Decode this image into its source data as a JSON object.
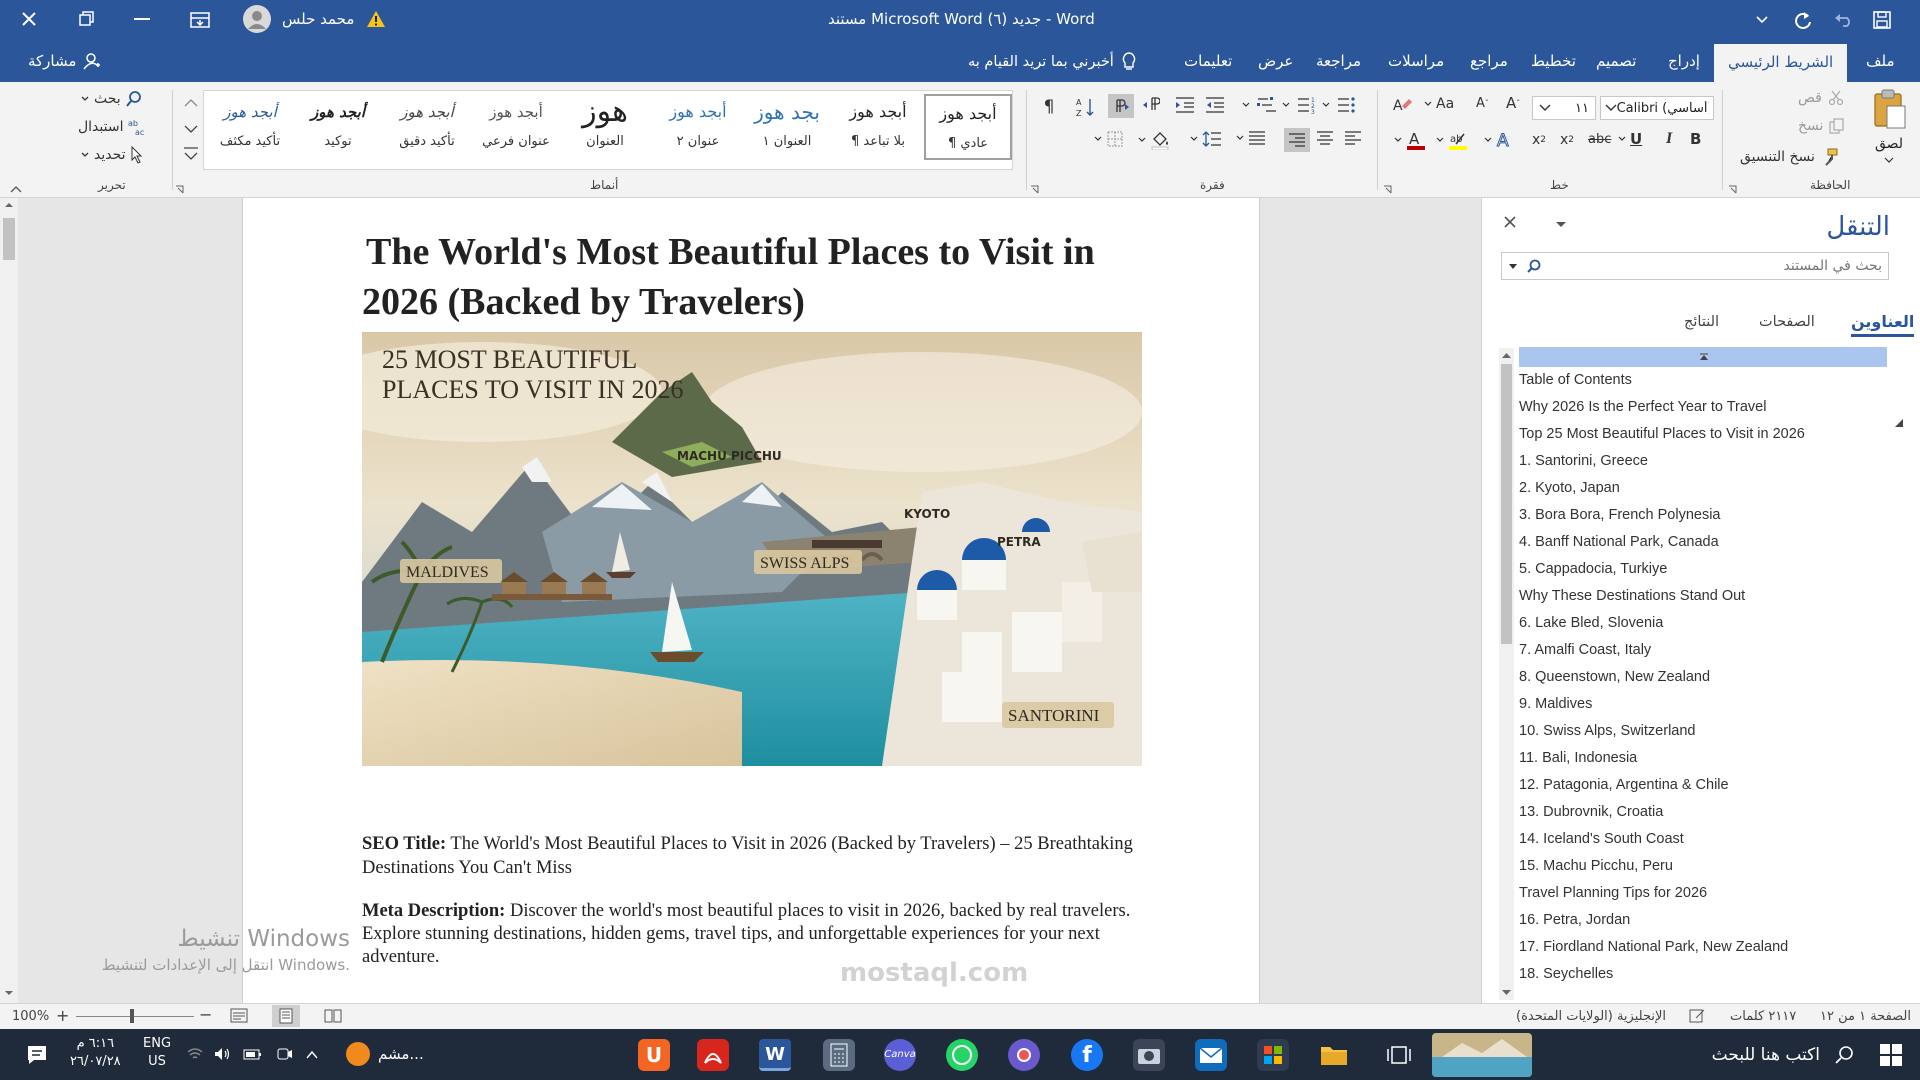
{
  "titlebar": {
    "doc_title": "مستند Microsoft Word جديد (٦)  -  Word",
    "user_name": "محمد حلس"
  },
  "tabs": [
    "ملف",
    "الشريط الرئيسي",
    "إدراج",
    "تصميم",
    "تخطيط",
    "مراجع",
    "مراسلات",
    "مراجعة",
    "عرض",
    "تعليمات"
  ],
  "tell_me": "أخبرني بما تريد القيام به",
  "share": "مشاركة",
  "ribbon": {
    "clipboard": {
      "paste": "لصق",
      "cut": "قص",
      "copy": "نسخ",
      "format_painter": "نسخ التنسيق",
      "label": "الحافظة"
    },
    "font": {
      "name": "Calibri (أساسي)",
      "size": "١١",
      "label": "خط"
    },
    "paragraph": {
      "label": "فقرة"
    },
    "styles": {
      "label": "أنماط",
      "items": [
        {
          "preview": "أبجد هوز",
          "name": "¶ عادي"
        },
        {
          "preview": "أبجد هوز",
          "name": "¶ بلا تباعد"
        },
        {
          "preview": "بجد هوز",
          "name": "العنوان ١"
        },
        {
          "preview": "أبجد هوز",
          "name": "عنوان ٢"
        },
        {
          "preview": "هوز",
          "name": "العنوان"
        },
        {
          "preview": "أبجد هوز",
          "name": "عنوان فرعي"
        },
        {
          "preview": "أبجد هوز",
          "name": "تأكيد دقيق"
        },
        {
          "preview": "أبجد هوز",
          "name": "توكيد"
        },
        {
          "preview": "أبجد هوز",
          "name": "تأكيد مكثف"
        }
      ]
    },
    "editing": {
      "find": "بحث",
      "replace": "استبدال",
      "select": "تحديد",
      "label": "تحرير"
    }
  },
  "document": {
    "title_line1": "The World's Most Beautiful Places to Visit in",
    "title_line2": "2026 (Backed by Travelers)",
    "image": {
      "heading_line1": "25 MOST BEAUTIFUL",
      "heading_line2": "PLACES TO VISIT IN 2026",
      "labels": [
        "MACHU PICCHU",
        "KYOTO",
        "PETRA",
        "MALDIVES",
        "SWISS ALPS",
        "SANTORINI"
      ]
    },
    "seo_label": "SEO Title:",
    "seo_text": " The World's Most Beautiful Places to Visit in 2026 (Backed by Travelers) – 25 Breathtaking Destinations You Can't Miss",
    "meta_label": "Meta Description:",
    "meta_text": " Discover the world's most beautiful places to visit in 2026, backed by real travelers. Explore stunning destinations, hidden gems, travel tips, and unforgettable experiences for your next adventure."
  },
  "activation": {
    "line1": "تنشيط Windows",
    "line2": "انتقل إلى الإعدادات لتنشيط Windows."
  },
  "watermark": "mostaql.com",
  "navpane": {
    "title": "التنقل",
    "search_placeholder": "بحث في المستند",
    "tabs": [
      "العناوين",
      "الصفحات",
      "النتائج"
    ],
    "items": [
      "Table of Contents",
      "Why 2026 Is the Perfect Year to Travel",
      "Top 25 Most Beautiful Places to Visit in 2026",
      "1. Santorini, Greece",
      "2. Kyoto, Japan",
      "3. Bora Bora, French Polynesia",
      "4. Banff National Park, Canada",
      "5. Cappadocia, Turkiye",
      "Why These Destinations Stand Out",
      "6. Lake Bled, Slovenia",
      "7. Amalfi Coast, Italy",
      "8. Queenstown, New Zealand",
      "9. Maldives",
      "10. Swiss Alps, Switzerland",
      "11. Bali, Indonesia",
      "12. Patagonia, Argentina & Chile",
      "13. Dubrovnik, Croatia",
      "14. Iceland's South Coast",
      "15. Machu Picchu, Peru",
      "Travel Planning Tips for 2026",
      "16. Petra, Jordan",
      "17. Fiordland National Park, New Zealand",
      "18. Seychelles"
    ]
  },
  "statusbar": {
    "page": "الصفحة ١ من ١٢",
    "words": "٢١١٧ كلمات",
    "language": "الإنجليزية (الولايات المتحدة)",
    "zoom": "100%"
  },
  "taskbar": {
    "search": "اكتب هنا للبحث",
    "lang1": "ENG",
    "lang2": "US",
    "time": "٦:١٦ م",
    "date": "٢٦/٠٧/٢٨",
    "weather": "مشم..."
  },
  "colors": {
    "accent": "#2b579a",
    "taskbar": "#1f2a3a"
  }
}
